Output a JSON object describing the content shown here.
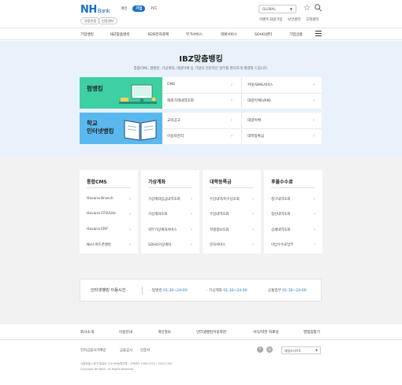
{
  "header": {
    "logo": "NH",
    "logo_suffix": "Bank",
    "tabs": [
      {
        "label": "개인"
      },
      {
        "label": "기업"
      },
      {
        "label": "카드"
      }
    ],
    "sub_buttons": [
      {
        "label": "공동인증"
      },
      {
        "label": "인증센터"
      }
    ],
    "global_select": "GLOBAL",
    "util_links": [
      "이벤트",
      "회원가입",
      "보안센터",
      "고객센터"
    ]
  },
  "gnb": {
    "items": [
      "기업뱅킹",
      "IBZ맞춤뱅킹",
      "B2B전자결제",
      "부가서비스",
      "외환서비스",
      "SOHO센터",
      "기업상품"
    ]
  },
  "hero": {
    "title": "IBZ맞춤뱅킹",
    "desc": "통합CMS, 펌뱅킹, 가상계좌, 대량이체 등 기업의 전문적인 업무를 편리하게 해결해 드립니다.",
    "card1": {
      "title": "펌뱅킹",
      "links": [
        "CMS",
        "커밋/SMS서비스",
        "해외거래내역조회",
        "대량이체(VAN)"
      ]
    },
    "card2": {
      "title_line1": "학교",
      "title_line2": "인터넷뱅킹",
      "links": [
        "교육공고",
        "대량이체",
        "이용자관리",
        "대학등록금"
      ]
    }
  },
  "sections": [
    {
      "title": "통합CMS",
      "items": [
        "Havana Branch",
        "Havana CFO/Lite",
        "Havana ERP",
        "NH스마트폰뱅킹"
      ]
    },
    {
      "title": "가상계좌",
      "items": [
        "가상계좌입금내역조회",
        "가상계좌조회",
        "외부가상계좌서비스",
        "SOHO가상계좌"
      ]
    },
    {
      "title": "대학등록금",
      "items": [
        "수납내역/미수납조회",
        "수납내역조회",
        "학생정보조회",
        "문자서비스"
      ]
    },
    {
      "title": "후불수수료",
      "items": [
        "청구내역조회",
        "정산내역조회",
        "상세내역조회",
        "미납수수료납부"
      ]
    }
  ],
  "hours": {
    "label": "인터넷뱅킹 이용시간",
    "entries": [
      {
        "name": "· 펌뱅킹",
        "time": "01:30~24:00"
      },
      {
        "name": "· 가상계좌",
        "time": "01:30~24:00"
      },
      {
        "name": "· 공통업무",
        "time": "01:30~24:00"
      }
    ]
  },
  "footer": {
    "top_links": [
      "회사소개",
      "이용안내",
      "개인정보",
      "인터넷뱅킹이용약관",
      "서식/약관 자료실",
      "영업점찾기"
    ],
    "sub_links": [
      "전자금융사기예방",
      "금융공시",
      "인증서"
    ],
    "family_select": "패밀리사이트",
    "address_line": "서울특별시 중구 통일로 120 NH농협은행 · 고객센터 1588-2100 / 1544-2100",
    "copyright": "Copyright NH Bank. All Rights Reserved."
  }
}
